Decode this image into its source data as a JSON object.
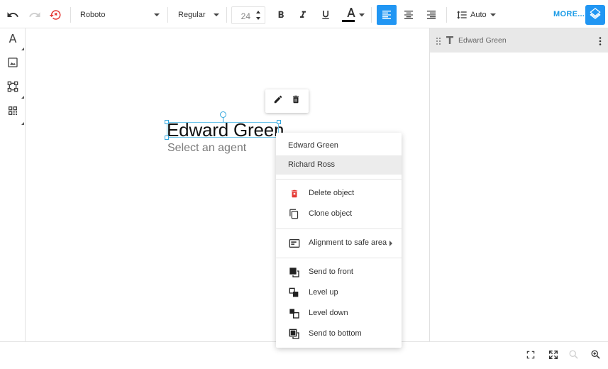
{
  "toolbar": {
    "font_family": "Roboto",
    "font_weight": "Regular",
    "font_size": "24",
    "line_height": "Auto",
    "more_label": "MORE...",
    "text_color": "#111111"
  },
  "canvas": {
    "text_main": "Edward Green",
    "text_sub": "Select an agent"
  },
  "layers": {
    "items": [
      {
        "label": "Edward Green",
        "type_icon": "text-icon"
      }
    ]
  },
  "context_menu": {
    "options": [
      "Edward Green",
      "Richard Ross"
    ],
    "selected_option": "Richard Ross",
    "actions": {
      "delete": "Delete object",
      "clone": "Clone object",
      "alignment": "Alignment to safe area",
      "send_front": "Send to front",
      "level_up": "Level up",
      "level_down": "Level down",
      "send_bottom": "Send to bottom"
    }
  },
  "colors": {
    "accent": "#2196f3",
    "more_text": "#1a9be6",
    "selection": "#34a7dd",
    "delete_red": "#e53935"
  }
}
